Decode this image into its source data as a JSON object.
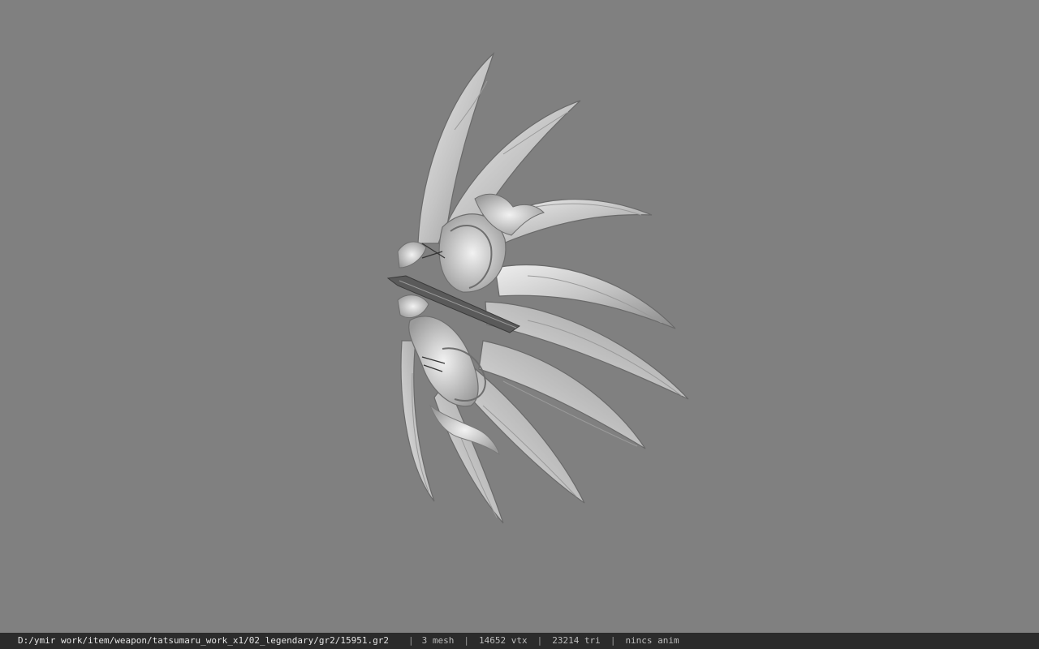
{
  "status_bar": {
    "file_path": "D:/ymir work/item/weapon/tatsumaru_work_x1/02_legendary/gr2/15951.gr2",
    "separator": "|",
    "mesh_count": "3 mesh",
    "vertex_count": "14652 vtx",
    "triangle_count": "23214 tri",
    "animation": "nincs anim"
  },
  "colors": {
    "viewport_background": "#808080",
    "status_bar_background": "#2b2b2b",
    "model_light": "#e6e6e6",
    "model_mid": "#bcbcbc",
    "model_dark": "#5a5a5a"
  }
}
